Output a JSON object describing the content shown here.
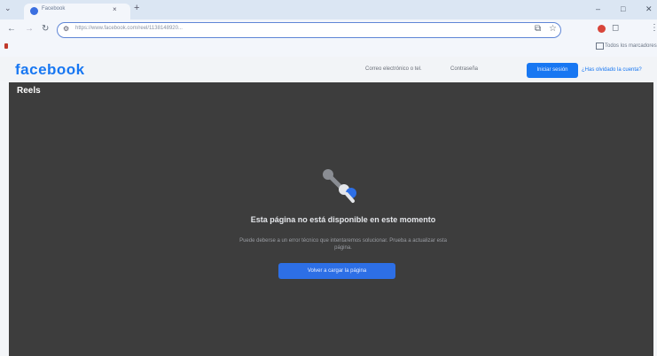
{
  "browser": {
    "tab_title": "Facebook",
    "tab_close": "×",
    "new_tab": "+",
    "tab_search": "⌄",
    "url": "https://www.facebook.com/reel/1138148920...",
    "controls": {
      "minimize": "–",
      "maximize": "□",
      "close": "✕"
    },
    "nav": {
      "back": "←",
      "forward": "→",
      "reload": "↻"
    },
    "bookmarks_all_label": "Todos los marcadores"
  },
  "facebook": {
    "logo": "facebook",
    "email_label": "Correo electrónico o tel.",
    "password_label": "Contraseña",
    "login_button": "Iniciar sesión",
    "forgot_link": "¿Has olvidado la cuenta?"
  },
  "reels": {
    "title": "Reels",
    "error_title": "Esta página no está disponible en este momento",
    "error_description": "Puede deberse a un error técnico que intentaremos solucionar. Prueba a actualizar esta página.",
    "reload_button": "Volver a cargar la página"
  }
}
